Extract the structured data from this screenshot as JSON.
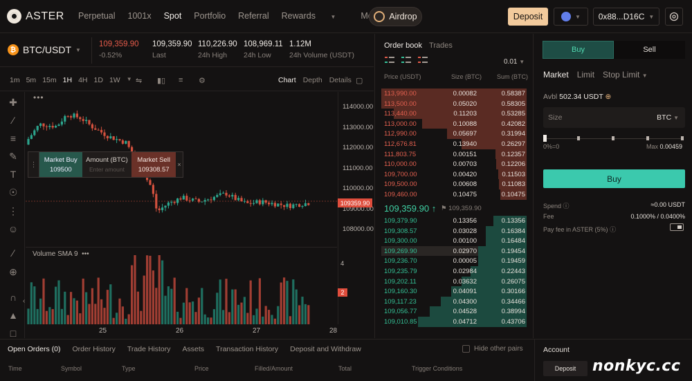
{
  "nav": {
    "brand": "ASTER",
    "links": [
      "Perpetual",
      "1001x",
      "Spot",
      "Portfolio",
      "Referral",
      "Rewards",
      "More"
    ],
    "active_link": "Spot",
    "airdrop": "Airdrop",
    "deposit": "Deposit",
    "wallet": "0x88...D16C"
  },
  "ticker": {
    "pair": "BTC/USDT",
    "price": "109,359.90",
    "change": "-0.52%",
    "last": "109,359.90",
    "last_label": "Last",
    "high": "110,226.90",
    "high_label": "24h High",
    "low": "108,969.11",
    "low_label": "24h Low",
    "volume": "1.12M",
    "volume_label": "24h Volume (USDT)"
  },
  "chart_toolbar": {
    "intervals": [
      "1m",
      "5m",
      "15m",
      "1H",
      "4H",
      "1D",
      "1W"
    ],
    "active_interval": "1H",
    "views": [
      "Chart",
      "Depth",
      "Details"
    ],
    "active_view": "Chart"
  },
  "chart": {
    "y_labels": [
      "114000.00",
      "113000.00",
      "112000.00",
      "111000.00",
      "110000.00",
      "109000.00",
      "108000.00"
    ],
    "current_price_tag": "109359.90",
    "x_labels": [
      "25",
      "26",
      "27",
      "28"
    ],
    "volume_label": "Volume SMA 9",
    "volume_axis_top": "4",
    "volume_tag": "2",
    "up_color": "#2ca58d",
    "down_color": "#d4513e"
  },
  "order_panel": {
    "buy_label": "Market Buy",
    "buy_price": "109500",
    "amount_label": "Amount (BTC)",
    "amount_placeholder": "Enter amount",
    "sell_label": "Market Sell",
    "sell_price": "109308.57"
  },
  "orderbook": {
    "tabs": [
      "Order book",
      "Trades"
    ],
    "precision": "0.01",
    "headers": [
      "Price (USDT)",
      "Size (BTC)",
      "Sum (BTC)"
    ],
    "asks": [
      {
        "price": "113,990.00",
        "size": "0.00082",
        "sum": "0.58387",
        "depth": 1.0
      },
      {
        "price": "113,500.00",
        "size": "0.05020",
        "sum": "0.58305",
        "depth": 0.998
      },
      {
        "price": "113,440.00",
        "size": "0.11203",
        "sum": "0.53285",
        "depth": 0.913
      },
      {
        "price": "113,000.00",
        "size": "0.10088",
        "sum": "0.42082",
        "depth": 0.721
      },
      {
        "price": "112,990.00",
        "size": "0.05697",
        "sum": "0.31994",
        "depth": 0.548
      },
      {
        "price": "112,676.81",
        "size": "0.13940",
        "sum": "0.26297",
        "depth": 0.45
      },
      {
        "price": "111,803.75",
        "size": "0.00151",
        "sum": "0.12357",
        "depth": 0.212
      },
      {
        "price": "110,000.00",
        "size": "0.00703",
        "sum": "0.12206",
        "depth": 0.209
      },
      {
        "price": "109,700.00",
        "size": "0.00420",
        "sum": "0.11503",
        "depth": 0.197
      },
      {
        "price": "109,500.00",
        "size": "0.00608",
        "sum": "0.11083",
        "depth": 0.19
      },
      {
        "price": "109,460.00",
        "size": "0.10475",
        "sum": "0.10475",
        "depth": 0.179
      }
    ],
    "mid_price": "109,359.90",
    "mid_arrow": "↑",
    "mark_price": "109,359.90",
    "bids": [
      {
        "price": "109,379.90",
        "size": "0.13356",
        "sum": "0.13356",
        "depth": 0.229
      },
      {
        "price": "109,308.57",
        "size": "0.03028",
        "sum": "0.16384",
        "depth": 0.281
      },
      {
        "price": "109,300.00",
        "size": "0.00100",
        "sum": "0.16484",
        "depth": 0.282
      },
      {
        "price": "109,269.90",
        "size": "0.02970",
        "sum": "0.19454",
        "depth": 0.333
      },
      {
        "price": "109,236.70",
        "size": "0.00005",
        "sum": "0.19459",
        "depth": 0.333
      },
      {
        "price": "109,235.79",
        "size": "0.02984",
        "sum": "0.22443",
        "depth": 0.384
      },
      {
        "price": "109,202.11",
        "size": "0.03632",
        "sum": "0.26075",
        "depth": 0.447
      },
      {
        "price": "109,160.30",
        "size": "0.04091",
        "sum": "0.30166",
        "depth": 0.517
      },
      {
        "price": "109,117.23",
        "size": "0.04300",
        "sum": "0.34466",
        "depth": 0.59
      },
      {
        "price": "109,056.77",
        "size": "0.04528",
        "sum": "0.38994",
        "depth": 0.668
      },
      {
        "price": "109,010.85",
        "size": "0.04712",
        "sum": "0.43706",
        "depth": 0.749
      }
    ]
  },
  "trade": {
    "buy_tab": "Buy",
    "sell_tab": "Sell",
    "order_types": [
      "Market",
      "Limit",
      "Stop Limit"
    ],
    "avbl_label": "Avbl",
    "avbl_value": "502.34 USDT",
    "size_placeholder": "Size",
    "size_unit": "BTC",
    "slider_min": "0%=0",
    "slider_max_label": "Max",
    "slider_max": "0.00459",
    "buy_button": "Buy",
    "spend_label": "Spend",
    "spend_value": "≈0.00 USDT",
    "fee_label": "Fee",
    "fee_value": "0.1000% / 0.0400%",
    "pay_fee_label": "Pay fee in ASTER (5%)"
  },
  "bottom": {
    "tabs": [
      "Open Orders (0)",
      "Order History",
      "Trade History",
      "Assets",
      "Transaction History",
      "Deposit and Withdraw"
    ],
    "hide_other": "Hide other pairs",
    "columns": [
      "Time",
      "Symbol",
      "Type",
      "Price",
      "Filled/Amount",
      "Total",
      "Trigger Conditions"
    ],
    "account_title": "Account",
    "account_deposit": "Deposit",
    "watermark": "nonkyc.cc"
  }
}
